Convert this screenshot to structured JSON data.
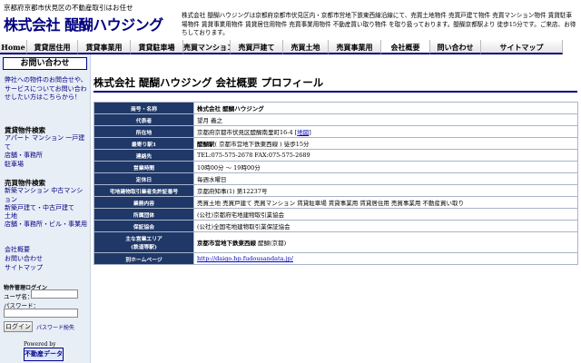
{
  "header": {
    "tagline": "京都府京都市伏見区の不動産取引はお任せ",
    "company_name": "株式会社 醍醐ハウジング",
    "description": "株式会社 醍醐ハウジングは京都府京都市伏見区内・京都市営地下鉄東西線沿線にて、売買土地物件 売買戸建て物件 売買マンション物件 賃貸駐車場物件 賃貸事業用物件 賃貸居住用物件 売買事業用物件 不動産買い取り物件 を取り扱っております。醍醐京都駅より 徒歩15分です。ご来店、お待ちしております。"
  },
  "nav": [
    {
      "label": "Home",
      "width": 30
    },
    {
      "label": "賃貸居住用",
      "width": 56
    },
    {
      "label": "賃貸事業用",
      "width": 58
    },
    {
      "label": "賃貸駐車場",
      "width": 58
    },
    {
      "label": "売買マンション",
      "width": 52
    },
    {
      "label": "売買戸建て",
      "width": 58
    },
    {
      "label": "売買土地",
      "width": 50
    },
    {
      "label": "売買事業用",
      "width": 58
    },
    {
      "label": "会社概要",
      "width": 54
    },
    {
      "label": "問い合わせ",
      "width": 56
    },
    {
      "label": "サイトマップ",
      "width": 90
    }
  ],
  "sidebar": {
    "inquiry_title": "お問い合わせ",
    "inquiry_text": "弊社への物件のお問合せや、サービスについてお問い合わせしたい方はこちらから！",
    "rental_heading": "賃貸物件検索",
    "rental_links": [
      "アパート マンション 一戸建て",
      "店舗・事務所",
      "駐車場"
    ],
    "sale_heading": "売買物件検索",
    "sale_links": [
      "新築マンション 中古マンション",
      "新築戸建て・中古戸建て",
      "土地",
      "店舗・事務所・ビル・事業用"
    ],
    "misc_links": [
      "会社概要",
      "お問い合わせ",
      "サイトマップ"
    ],
    "login_title": "物件管理ログイン",
    "user_label": "ユーザ名：",
    "pass_label": "パスワード：",
    "login_button": "ログイン",
    "forgot_link": "パスワード紛失",
    "powered_by": "Powered by",
    "powered_logo": "不動産データ"
  },
  "main": {
    "title": "株式会社 醍醐ハウジング 会社概要 プロフィール",
    "rows": [
      {
        "key": "商号・名称",
        "value": "株式会社 醍醐ハウジング",
        "bold": true
      },
      {
        "key": "代表者",
        "value": "望月 義之"
      },
      {
        "key": "所在地",
        "value": "京都府京都市伏見区醍醐南里町16-4",
        "link": "地図"
      },
      {
        "key": "最寄り駅1",
        "value": "醍醐駅",
        "value_rest": "( 京都市営地下鉄東西線 ) 徒歩15分"
      },
      {
        "key": "連絡先",
        "value": "TEL:075-575-2678 FAX:075-575-2689"
      },
      {
        "key": "営業時間",
        "value": "10時00分 ～ 19時00分"
      },
      {
        "key": "定休日",
        "value": "毎週水曜日"
      },
      {
        "key": "宅地建物取引業者免許証番号",
        "value": "京都府知事(1) 第12237号"
      },
      {
        "key": "業務内容",
        "value": "売買土地 売買戸建て 売買マンション 賃貸駐車場 賃貸事業用 賃貸居住用 売買事業用 不動産買い取り"
      },
      {
        "key": "所属団体",
        "value": "(公社)京都府宅地建物取引業協会"
      },
      {
        "key": "保証協会",
        "value": "(公社)全国宅地建物取引業保証協会"
      },
      {
        "key": "主な営業エリア\n(鉄道等駅)",
        "value": "京都市営地下鉄東西線",
        "value_rest": " 醍醐(京都)",
        "tall": true
      },
      {
        "key": "別ホームページ",
        "value": "http://daigo.hp.fudousandata.jp/"
      }
    ]
  }
}
